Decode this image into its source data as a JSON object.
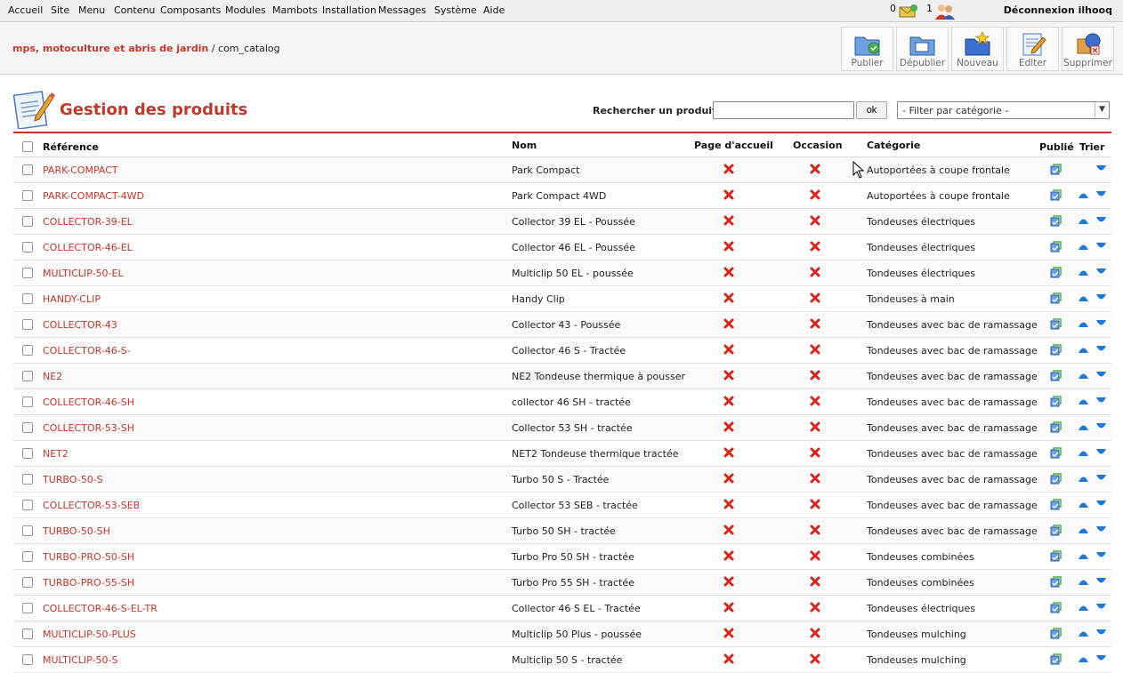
{
  "menu": [
    "Accueil",
    "Site",
    "Menu",
    "Contenu",
    "Composants",
    "Modules",
    "Mambots",
    "Installation",
    "Messages",
    "Système",
    "Aide"
  ],
  "status": {
    "messages_count": "0",
    "users_count": "1",
    "logout": "Déconnexion ilhooq"
  },
  "breadcrumb": {
    "site": "mps, motoculture et abris de jardin",
    "component": "/ com_catalog"
  },
  "toolbar": [
    {
      "label": "Publier",
      "icon": "publish-icon"
    },
    {
      "label": "Dépublier",
      "icon": "unpublish-icon"
    },
    {
      "label": "Nouveau",
      "icon": "new-icon"
    },
    {
      "label": "Editer",
      "icon": "edit-icon"
    },
    {
      "label": "Supprimer",
      "icon": "delete-icon"
    }
  ],
  "page": {
    "title": "Gestion des produits"
  },
  "search": {
    "label": "Rechercher un produit:",
    "value": "",
    "ok_label": "ok"
  },
  "filter": {
    "selected": "- Filter par catégorie -"
  },
  "table": {
    "headers": {
      "reference": "Référence",
      "nom": "Nom",
      "accueil": "Page d'accueil",
      "occasion": "Occasion",
      "categorie": "Catégorie",
      "publie": "Publié",
      "trier": "Trier"
    },
    "rows": [
      {
        "ref": "PARK-COMPACT",
        "nom": "Park Compact",
        "cat": "Autoportées à coupe frontale",
        "up": false,
        "down": true
      },
      {
        "ref": "PARK-COMPACT-4WD",
        "nom": "Park Compact 4WD",
        "cat": "Autoportées à coupe frontale",
        "up": true,
        "down": true
      },
      {
        "ref": "COLLECTOR-39-EL",
        "nom": "Collector 39 EL - Poussée",
        "cat": "Tondeuses électriques",
        "up": true,
        "down": true
      },
      {
        "ref": "COLLECTOR-46-EL",
        "nom": "Collector 46 EL - Poussée",
        "cat": "Tondeuses électriques",
        "up": true,
        "down": true
      },
      {
        "ref": "MULTICLIP-50-EL",
        "nom": "Multiclip 50 EL - poussée",
        "cat": "Tondeuses électriques",
        "up": true,
        "down": true
      },
      {
        "ref": "HANDY-CLIP",
        "nom": "Handy Clip",
        "cat": "Tondeuses à main",
        "up": true,
        "down": true
      },
      {
        "ref": "COLLECTOR-43",
        "nom": "Collector 43 - Poussée",
        "cat": "Tondeuses avec bac de ramassage",
        "up": true,
        "down": true
      },
      {
        "ref": "COLLECTOR-46-S-",
        "nom": "Collector 46 S - Tractée",
        "cat": "Tondeuses avec bac de ramassage",
        "up": true,
        "down": true
      },
      {
        "ref": "NE2",
        "nom": "NE2 Tondeuse thermique à pousser",
        "cat": "Tondeuses avec bac de ramassage",
        "up": true,
        "down": true
      },
      {
        "ref": "COLLECTOR-46-SH",
        "nom": "collector 46 SH - tractée",
        "cat": "Tondeuses avec bac de ramassage",
        "up": true,
        "down": true
      },
      {
        "ref": "COLLECTOR-53-SH",
        "nom": "Collector 53 SH - tractée",
        "cat": "Tondeuses avec bac de ramassage",
        "up": true,
        "down": true
      },
      {
        "ref": "NET2",
        "nom": "NET2 Tondeuse thermique tractée",
        "cat": "Tondeuses avec bac de ramassage",
        "up": true,
        "down": true
      },
      {
        "ref": "TURBO-50-S",
        "nom": "Turbo 50 S - Tractée",
        "cat": "Tondeuses avec bac de ramassage",
        "up": true,
        "down": true
      },
      {
        "ref": "COLLECTOR-53-SEB",
        "nom": "Collector 53 SEB - tractée",
        "cat": "Tondeuses avec bac de ramassage",
        "up": true,
        "down": true
      },
      {
        "ref": "TURBO-50-SH",
        "nom": "Turbo 50 SH - tractée",
        "cat": "Tondeuses avec bac de ramassage",
        "up": true,
        "down": true
      },
      {
        "ref": "TURBO-PRO-50-SH",
        "nom": "Turbo Pro 50 SH - tractée",
        "cat": "Tondeuses combinées",
        "up": true,
        "down": true
      },
      {
        "ref": "TURBO-PRO-55-SH",
        "nom": "Turbo Pro 55 SH - tractée",
        "cat": "Tondeuses combinées",
        "up": true,
        "down": true
      },
      {
        "ref": "COLLECTOR-46-S-EL-TR",
        "nom": "Collector 46 S EL - Tractée",
        "cat": "Tondeuses électriques",
        "up": true,
        "down": true
      },
      {
        "ref": "MULTICLIP-50-PLUS",
        "nom": "Multiclip 50 Plus - poussée",
        "cat": "Tondeuses mulching",
        "up": true,
        "down": true
      },
      {
        "ref": "MULTICLIP-50-S",
        "nom": "Multiclip 50 S - tractée",
        "cat": "Tondeuses mulching",
        "up": true,
        "down": true
      }
    ]
  },
  "colors": {
    "accent": "#c0392b",
    "arrow": "#1f78d1",
    "xmark": "#d0281b"
  }
}
